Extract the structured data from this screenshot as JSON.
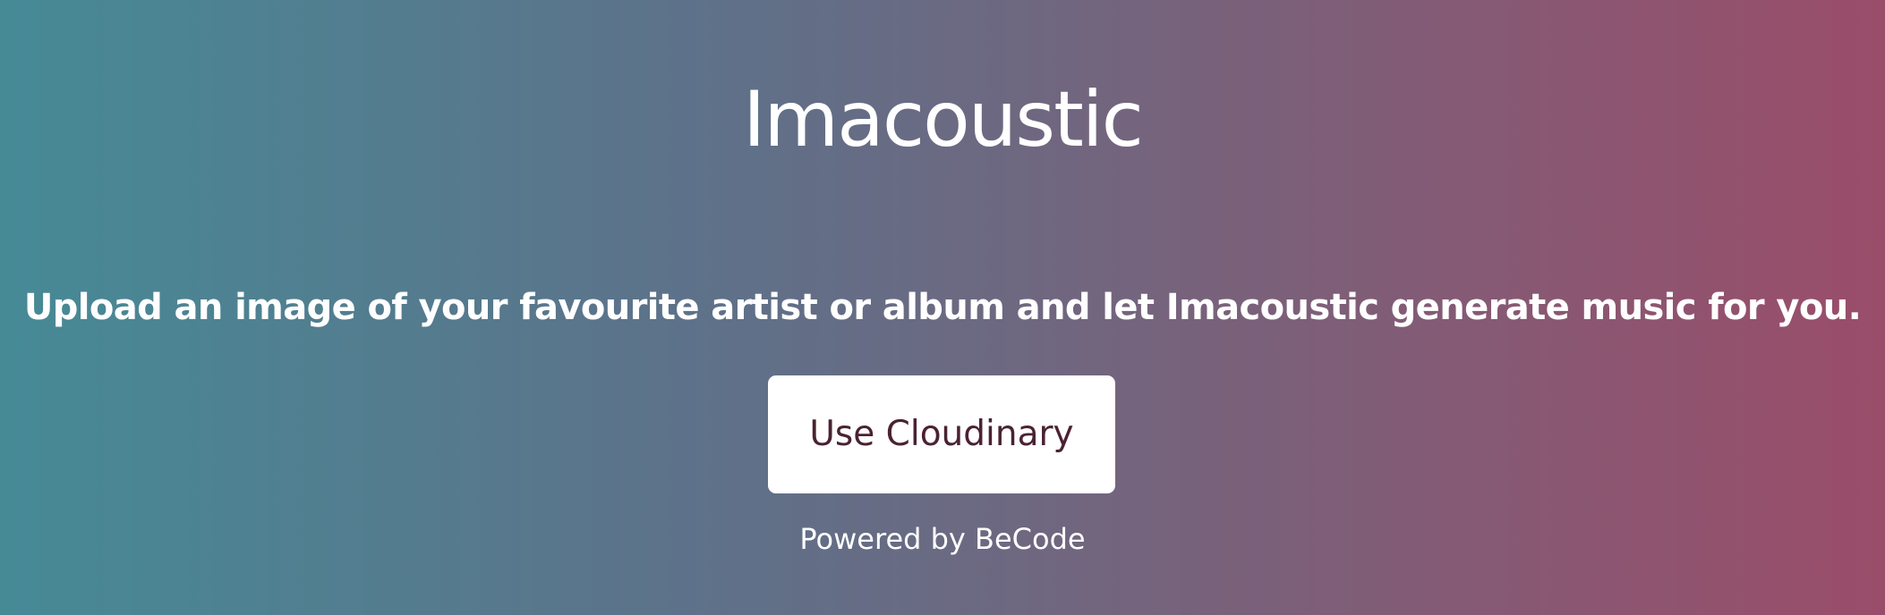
{
  "header": {
    "title": "Imacoustic"
  },
  "main": {
    "tagline": "Upload an image of your favourite artist or album and let Imacoustic generate music for you.",
    "upload_button_label": "Use Cloudinary"
  },
  "footer": {
    "credit": "Powered by BeCode"
  },
  "colors": {
    "gradient_left": "#468a96",
    "gradient_right": "#9a4d6a",
    "button_background": "#ffffff",
    "button_text": "#4a2233"
  }
}
